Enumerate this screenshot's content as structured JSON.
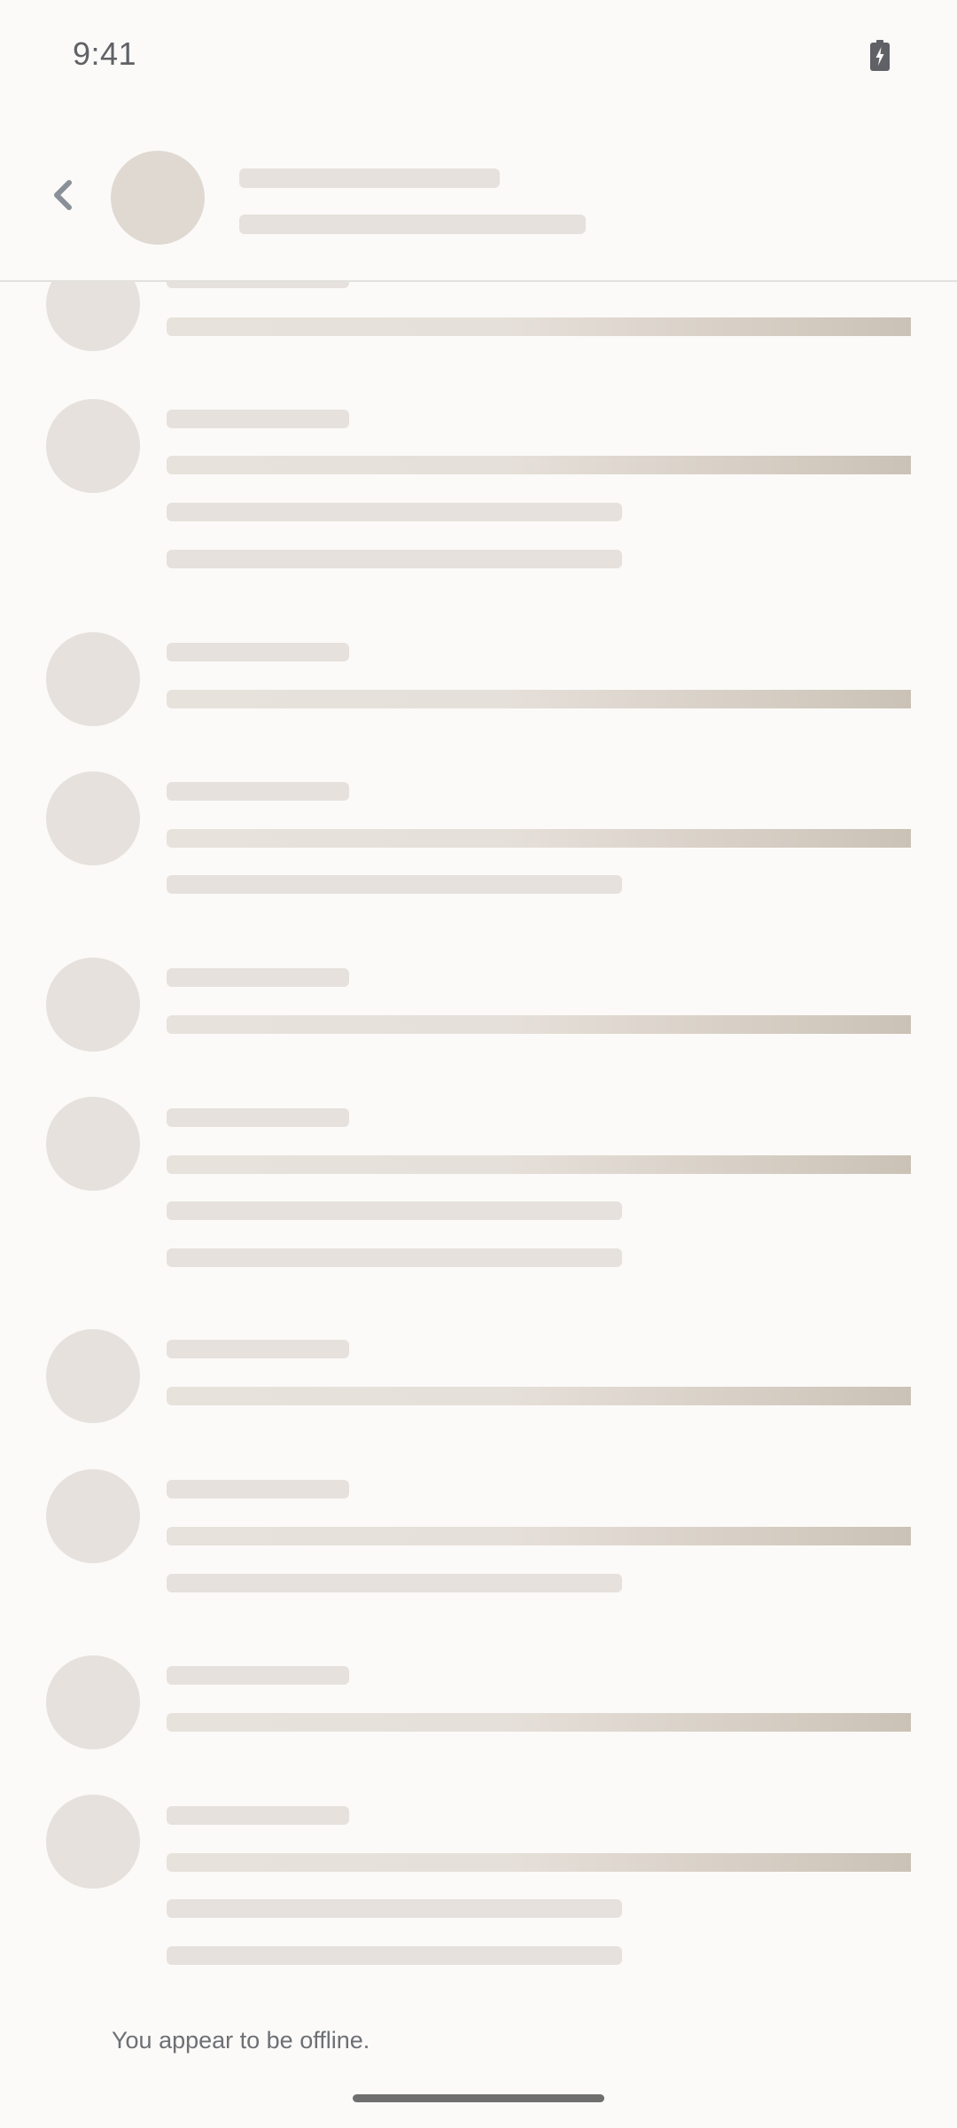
{
  "status_bar": {
    "time": "9:41",
    "battery_icon": "battery-charging-icon"
  },
  "header": {
    "back_icon": "chevron-left-icon",
    "loading": true
  },
  "footer": {
    "offline_message": "You appear to be offline."
  },
  "colors": {
    "background": "#fbfaf8",
    "skeleton": "#e6e1dc",
    "skeleton_shimmer": "#cbc2b6",
    "text_secondary": "#6d7075"
  }
}
